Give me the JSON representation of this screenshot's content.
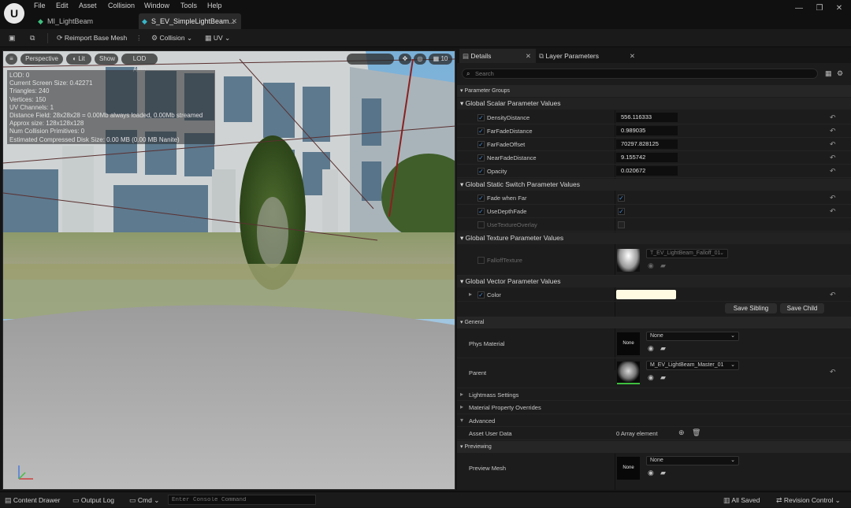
{
  "app": {
    "logo": "U"
  },
  "menu": [
    "File",
    "Edit",
    "Asset",
    "Collision",
    "Window",
    "Tools",
    "Help"
  ],
  "tabs": [
    {
      "label": "MI_LightBeam"
    },
    {
      "label": "S_EV_SimpleLightBeam..."
    }
  ],
  "toolbar": {
    "reimport": "Reimport Base Mesh",
    "collision": "Collision",
    "uv": "UV"
  },
  "viewport": {
    "perspective": "Perspective",
    "lit": "Lit",
    "show": "Show",
    "lod_auto": "LOD Auto",
    "grid_value": "10",
    "stats": [
      "LOD: 0",
      "Current Screen Size: 0.42271",
      "Triangles: 240",
      "Vertices: 150",
      "UV Channels: 1",
      "Distance Field: 28x28x28 = 0.00Mb always loaded, 0.00Mb streamed",
      "Approx size: 128x128x128",
      "Num Collision Primitives: 0",
      "Estimated Compressed Disk Size: 0.00 MB (0.00 MB Nanite)"
    ]
  },
  "panel": {
    "details_tab": "Details",
    "layer_tab": "Layer Parameters",
    "search_placeholder": "Search",
    "parameter_groups": "Parameter Groups",
    "scalar_header": "Global Scalar Parameter Values",
    "scalars": [
      {
        "name": "DensityDistance",
        "value": "556.116333"
      },
      {
        "name": "FarFadeDistance",
        "value": "0.989035"
      },
      {
        "name": "FarFadeOffset",
        "value": "70297.828125"
      },
      {
        "name": "NearFadeDistance",
        "value": "9.155742"
      },
      {
        "name": "Opacity",
        "value": "0.020672"
      }
    ],
    "switch_header": "Global Static Switch Parameter Values",
    "switches": [
      {
        "name": "Fade when Far",
        "checked": true
      },
      {
        "name": "UseDepthFade",
        "checked": true
      },
      {
        "name": "UseTextureOverlay",
        "checked": false
      }
    ],
    "texture_header": "Global Texture Parameter Values",
    "texture": {
      "name": "FalloffTexture",
      "asset": "T_EV_LightBeam_Falloff_01"
    },
    "vector_header": "Global Vector Parameter Values",
    "vector": {
      "name": "Color",
      "color": "#fffbe3"
    },
    "save_sibling": "Save Sibling",
    "save_child": "Save Child",
    "general": "General",
    "phys_material": "Phys Material",
    "phys_value": "None",
    "phys_thumb": "None",
    "parent": "Parent",
    "parent_value": "M_EV_LightBeam_Master_01",
    "lightmass": "Lightmass Settings",
    "overrides": "Material Property Overrides",
    "advanced": "Advanced",
    "asset_user_data": "Asset User Data",
    "array_element": "0 Array element",
    "previewing": "Previewing",
    "preview_mesh": "Preview Mesh",
    "preview_value": "None",
    "preview_thumb": "None"
  },
  "status": {
    "content_drawer": "Content Drawer",
    "output_log": "Output Log",
    "cmd": "Cmd",
    "console_placeholder": "Enter Console Command",
    "all_saved": "All Saved",
    "revision": "Revision Control"
  },
  "colors": {
    "accent": "#4a8bd6",
    "tab_active": "#2a2a2a",
    "vector_color": "#fffbe3"
  }
}
